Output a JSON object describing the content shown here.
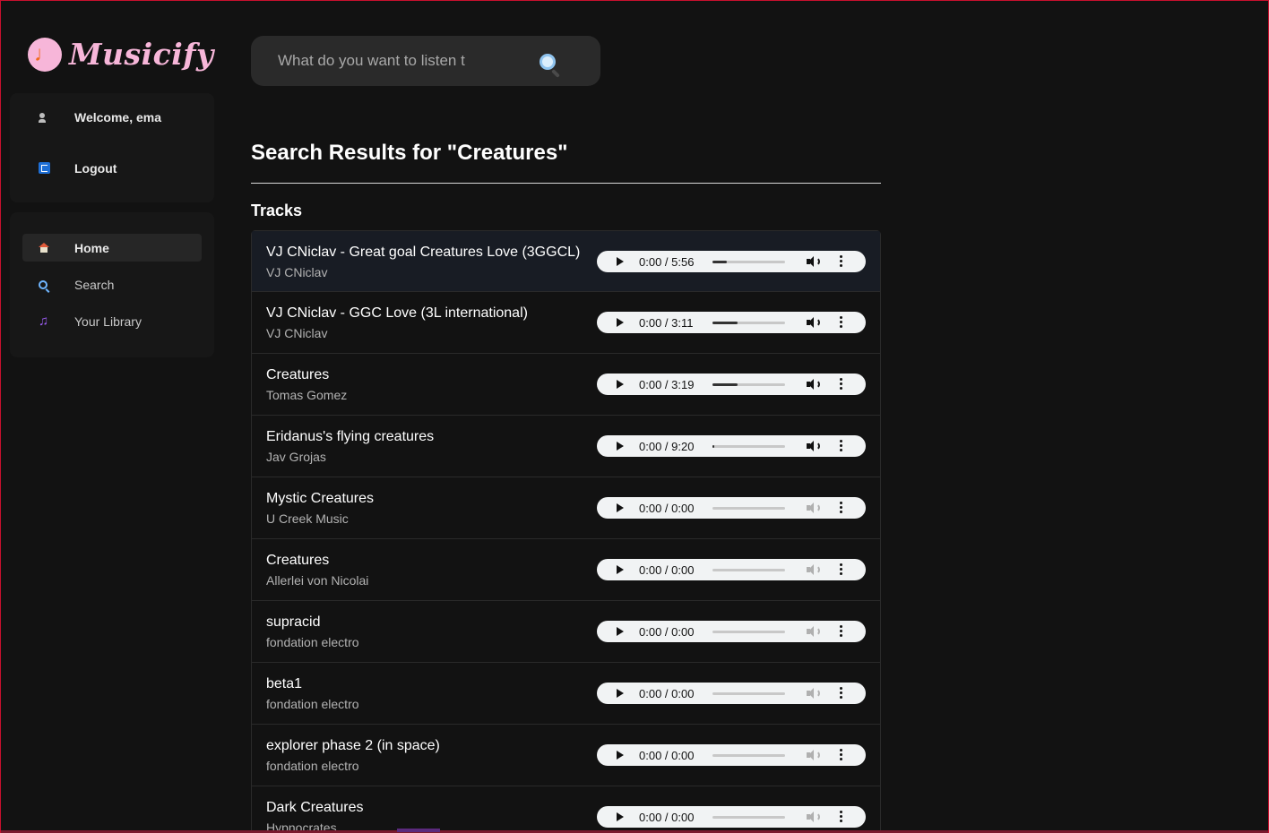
{
  "app": {
    "logo_text": "Musicify",
    "logo_glyph": "♩"
  },
  "user_panel": {
    "welcome": "Welcome, ema",
    "logout": "Logout"
  },
  "nav": {
    "items": [
      {
        "label": "Home",
        "icon": "home-icon",
        "active": true
      },
      {
        "label": "Search",
        "icon": "search-icon",
        "active": false
      },
      {
        "label": "Your Library",
        "icon": "music-note-icon",
        "active": false
      }
    ],
    "note_glyph": "♫"
  },
  "search": {
    "placeholder": "What do you want to listen t"
  },
  "results": {
    "heading": "Search Results for \"Creatures\"",
    "section": "Tracks",
    "tracks": [
      {
        "name": "VJ CNiclav - Great goal Creatures Love (3GGCL)",
        "artist": "VJ CNiclav",
        "time": "0:00 / 5:56",
        "volume": 0.2
      },
      {
        "name": "VJ CNiclav - GGC Love (3L international)",
        "artist": "VJ CNiclav",
        "time": "0:00 / 3:11",
        "volume": 0.35
      },
      {
        "name": "Creatures",
        "artist": "Tomas Gomez",
        "time": "0:00 / 3:19",
        "volume": 0.35
      },
      {
        "name": "Eridanus's flying creatures",
        "artist": "Jav Grojas",
        "time": "0:00 / 9:20",
        "volume": 0.02
      },
      {
        "name": "Mystic Creatures",
        "artist": "U Creek Music",
        "time": "0:00 / 0:00",
        "volume": 0
      },
      {
        "name": "Creatures",
        "artist": "Allerlei von Nicolai",
        "time": "0:00 / 0:00",
        "volume": 0
      },
      {
        "name": "supracid",
        "artist": "fondation electro",
        "time": "0:00 / 0:00",
        "volume": 0
      },
      {
        "name": "beta1",
        "artist": "fondation electro",
        "time": "0:00 / 0:00",
        "volume": 0
      },
      {
        "name": "explorer phase 2 (in space)",
        "artist": "fondation electro",
        "time": "0:00 / 0:00",
        "volume": 0
      },
      {
        "name": "Dark Creatures",
        "artist": "Hypnocrates",
        "time": "0:00 / 0:00",
        "volume": 0
      }
    ]
  },
  "colors": {
    "background": "#121212",
    "panel": "#171717",
    "brand_pink": "#f7b6d9",
    "accent_orange": "#f26a1b",
    "highlight_row": "#181c24"
  }
}
